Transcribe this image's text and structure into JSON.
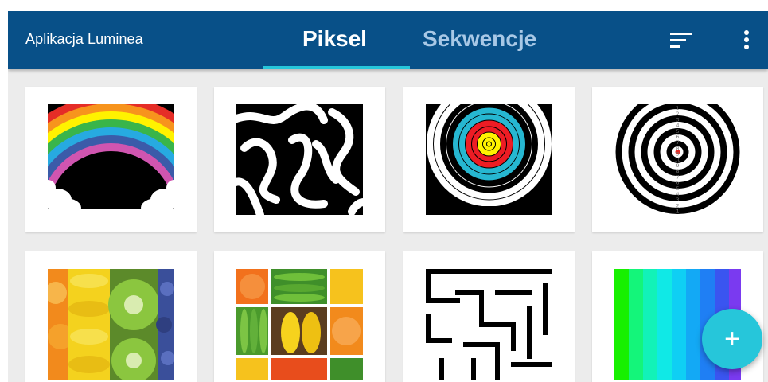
{
  "app": {
    "title": "Aplikacja Luminea"
  },
  "tabs": [
    {
      "label": "Piksel",
      "active": true
    },
    {
      "label": "Sekwencje",
      "active": false
    }
  ],
  "toolbar": {
    "sort_icon": "sort-icon",
    "more_icon": "more-vert-icon"
  },
  "colors": {
    "appbar": "#085088",
    "accent": "#26c6da",
    "background": "#ececec"
  },
  "grid": {
    "items": [
      {
        "name": "rainbow"
      },
      {
        "name": "maze-swirl"
      },
      {
        "name": "archery-target"
      },
      {
        "name": "dartboard"
      },
      {
        "name": "fruit-strips"
      },
      {
        "name": "fruit-grid"
      },
      {
        "name": "maze-lines"
      },
      {
        "name": "color-gradient"
      }
    ]
  },
  "dartboard_numbers": [
    "1",
    "2",
    "3",
    "4",
    "5",
    "6",
    "7",
    "8",
    "9",
    "10",
    "9",
    "8",
    "7",
    "6",
    "5",
    "4",
    "3",
    "2",
    "1"
  ],
  "fab": {
    "label": "+"
  }
}
